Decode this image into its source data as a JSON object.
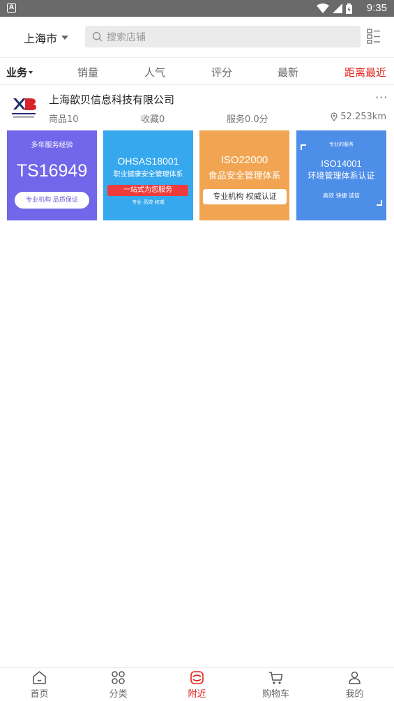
{
  "status_bar": {
    "app_indicator": "A",
    "time": "9:35"
  },
  "header": {
    "city": "上海市",
    "search_placeholder": "搜索店铺"
  },
  "filters": [
    "业务",
    "销量",
    "人气",
    "评分",
    "最新",
    "距离最近"
  ],
  "shop": {
    "name": "上海歆贝信息科技有限公司",
    "more": "···",
    "goods": "商品10",
    "favorites": "收藏0",
    "service": "服务0.0分",
    "distance": "52.253km"
  },
  "banners": {
    "b1": {
      "top": "多年服务经验",
      "big": "TS16949",
      "pill": "专业机构  品质保证"
    },
    "b2": {
      "t1": "OHSAS18001",
      "t2": "职业健康安全管理体系",
      "pill": "一站式为您服务",
      "t3": "专业  高效  权威"
    },
    "b3": {
      "t1": "ISO22000",
      "t2": "食品安全管理体系",
      "pill": "专业机构  权威认证"
    },
    "b4": {
      "t0": "专业的服务",
      "t1": "ISO14001",
      "t2": "环境管理体系认证",
      "t3": "高效    快捷    诚信"
    }
  },
  "tabs": [
    {
      "label": "首页",
      "icon": "home-icon"
    },
    {
      "label": "分类",
      "icon": "category-icon"
    },
    {
      "label": "附近",
      "icon": "nearby-icon"
    },
    {
      "label": "购物车",
      "icon": "cart-icon"
    },
    {
      "label": "我的",
      "icon": "user-icon"
    }
  ],
  "colors": {
    "accent": "#e2231a",
    "status_bar": "#6a6a6a"
  }
}
